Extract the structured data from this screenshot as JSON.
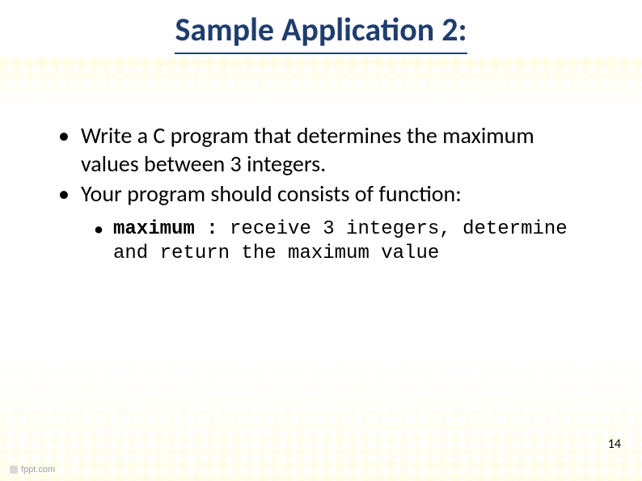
{
  "title": "Sample Application 2:",
  "bullets": {
    "b1": "Write a C program that determines the maximum values between 3 integers.",
    "b2": "Your program should consists of function:",
    "sub_bold": "maximum :",
    "sub_rest": " receive 3 integers, determine and return the maximum value"
  },
  "page_number": "14",
  "footer": "fppt.com"
}
